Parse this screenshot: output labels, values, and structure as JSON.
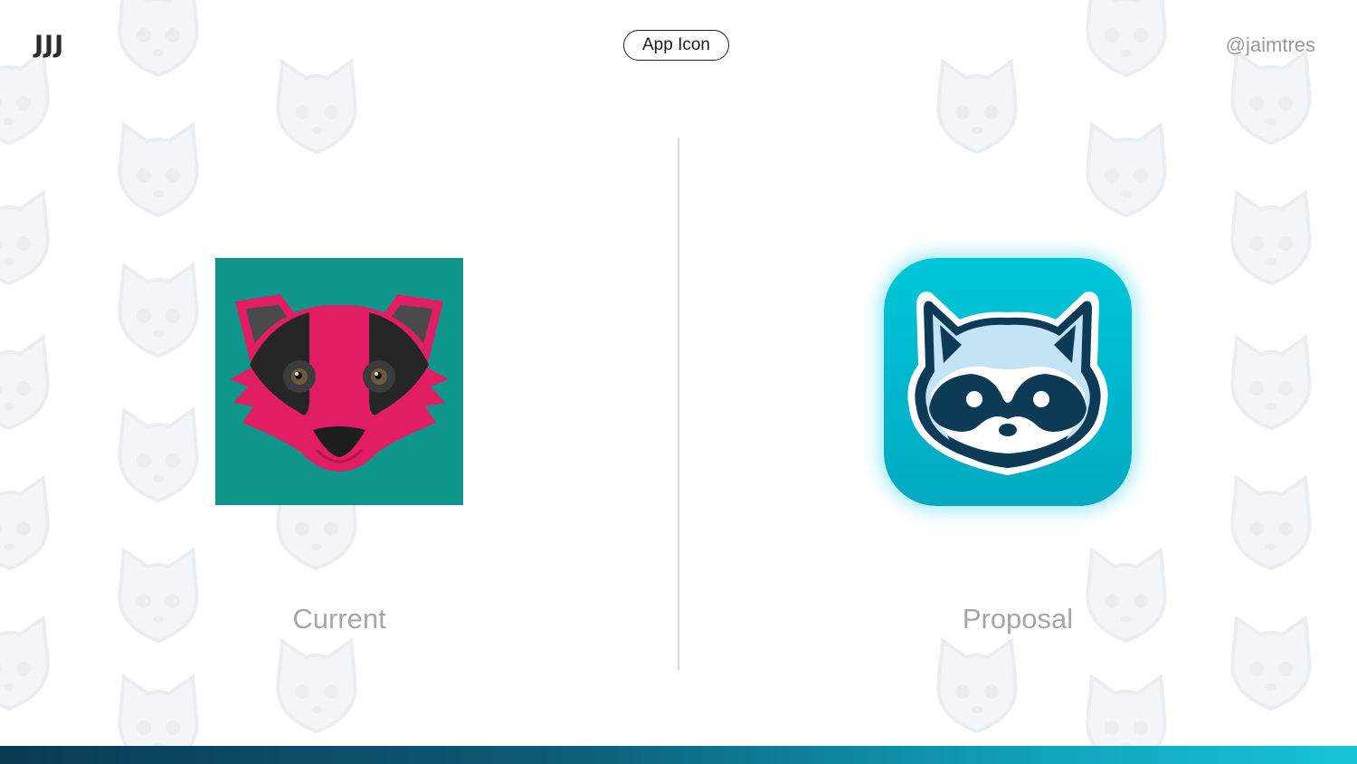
{
  "header": {
    "logo_text": "JJJ",
    "section_label": "App Icon",
    "handle": "@jaimtres"
  },
  "comparison": {
    "left": {
      "caption": "Current",
      "icon": "badger-face-icon"
    },
    "right": {
      "caption": "Proposal",
      "icon": "raccoon-face-icon"
    }
  },
  "colors": {
    "current_background": "#0e968a",
    "current_accent": "#e11d63",
    "proposal_background": "#00bcd4",
    "proposal_dark": "#0d3b56",
    "proposal_light": "#c5e3f6",
    "caption": "#a6a6a6",
    "bottom_bar_start": "#0a3c54",
    "bottom_bar_end": "#16c4d8"
  }
}
